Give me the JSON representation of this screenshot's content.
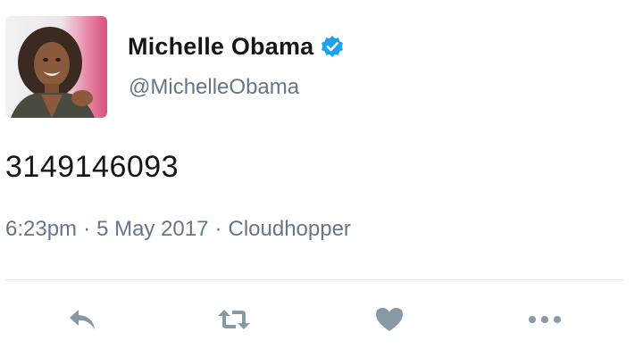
{
  "author": {
    "display_name": "Michelle Obama",
    "handle": "@MichelleObama",
    "verified": true,
    "avatar_icon": "profile-photo"
  },
  "tweet": {
    "text": "3149146093",
    "time": "6:23pm",
    "date": "5 May 2017",
    "source": "Cloudhopper",
    "separator": "·"
  },
  "actions": [
    {
      "name": "reply",
      "icon": "reply-icon"
    },
    {
      "name": "retweet",
      "icon": "retweet-icon"
    },
    {
      "name": "like",
      "icon": "heart-icon"
    },
    {
      "name": "more",
      "icon": "more-icon"
    }
  ],
  "colors": {
    "text_primary": "#14171a",
    "text_secondary": "#657786",
    "verified_blue": "#1da1f2",
    "action_gray": "#8899a6",
    "divider": "#e1e8ed"
  }
}
